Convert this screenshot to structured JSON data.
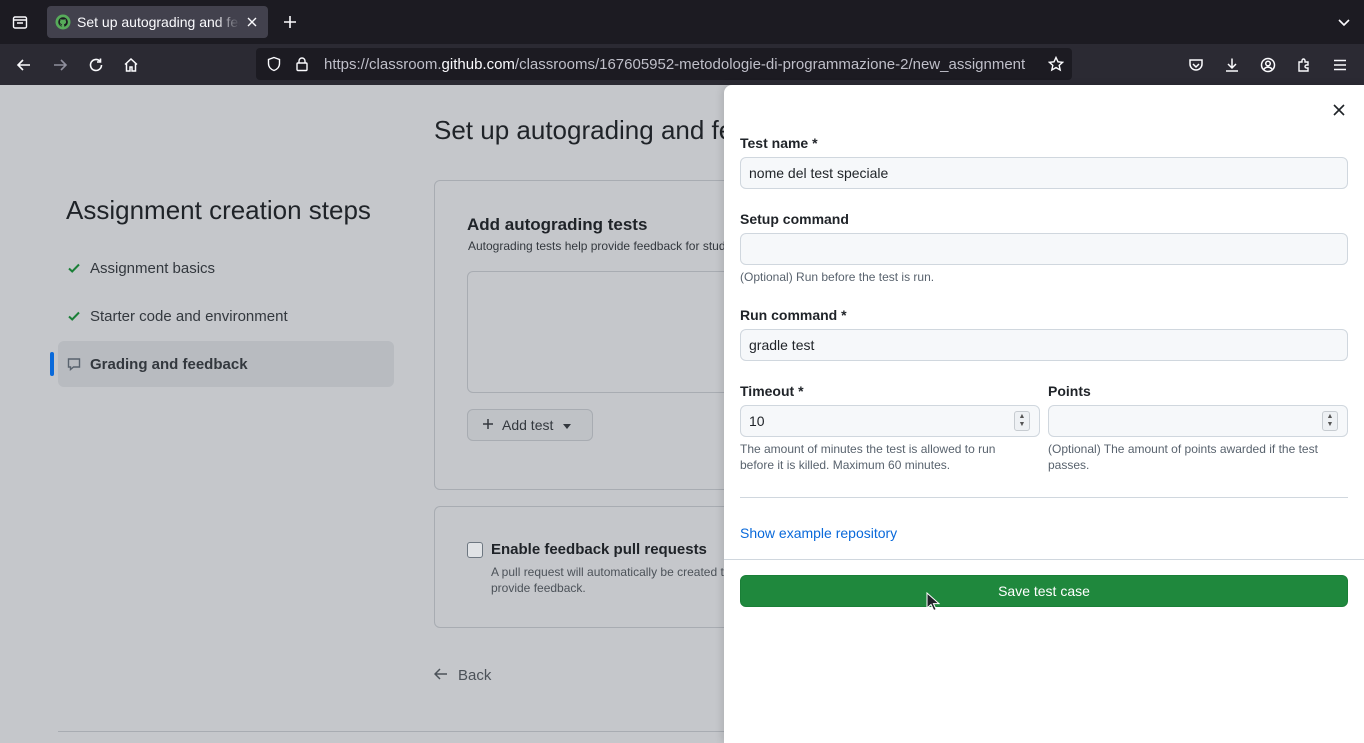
{
  "browser": {
    "tab_title": "Set up autograding and feedback",
    "url_prefix": "https://classroom.",
    "url_domain": "github.com",
    "url_path": "/classrooms/167605952-metodologie-di-programmazione-2/new_assignment"
  },
  "page": {
    "heading": "Set up autograding and feedback",
    "steps_title": "Assignment creation steps",
    "steps": [
      {
        "label": "Assignment basics",
        "icon": "check-icon"
      },
      {
        "label": "Starter code and environment",
        "icon": "check-icon"
      },
      {
        "label": "Grading and feedback",
        "icon": "comment-icon"
      }
    ],
    "autograding_title": "Add autograding tests",
    "autograding_sub": "Autograding tests help provide feedback for students",
    "add_test_label": "Add test",
    "feedback_title": "Enable feedback pull requests",
    "feedback_desc": "A pull request will automatically be created to provide feedback.",
    "back_label": "Back"
  },
  "dialog": {
    "test_name_label": "Test name *",
    "test_name_value": "nome del test speciale",
    "setup_label": "Setup command",
    "setup_value": "",
    "setup_hint": "(Optional) Run before the test is run.",
    "run_label": "Run command *",
    "run_value": "gradle test",
    "timeout_label": "Timeout *",
    "timeout_value": "10",
    "timeout_hint": "The amount of minutes the test is allowed to run before it is killed. Maximum 60 minutes.",
    "points_label": "Points",
    "points_value": "",
    "points_hint": "(Optional) The amount of points awarded if the test passes.",
    "example_link": "Show example repository",
    "save_label": "Save test case"
  },
  "colors": {
    "primary_button": "#1f883d",
    "link": "#0969da",
    "active_step_bar": "#0969da",
    "check": "#1a7f37"
  }
}
